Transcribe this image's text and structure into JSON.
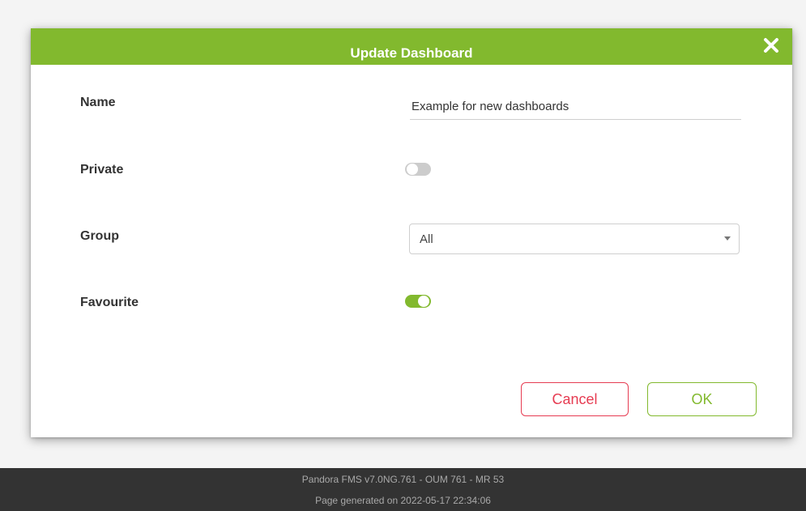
{
  "dialog": {
    "title": "Update Dashboard",
    "close_icon": "close-icon"
  },
  "form": {
    "name_label": "Name",
    "name_value": "Example for new dashboards",
    "private_label": "Private",
    "private_checked": false,
    "group_label": "Group",
    "group_value": "All",
    "favourite_label": "Favourite",
    "favourite_checked": true
  },
  "buttons": {
    "cancel_label": "Cancel",
    "ok_label": "OK"
  },
  "footer": {
    "version": "Pandora FMS v7.0NG.761 - OUM 761 - MR 53",
    "generated": "Page generated on 2022-05-17 22:34:06"
  },
  "colors": {
    "accent_green": "#82b92e",
    "cancel_red": "#e63c52",
    "footer_bg": "#333333"
  }
}
